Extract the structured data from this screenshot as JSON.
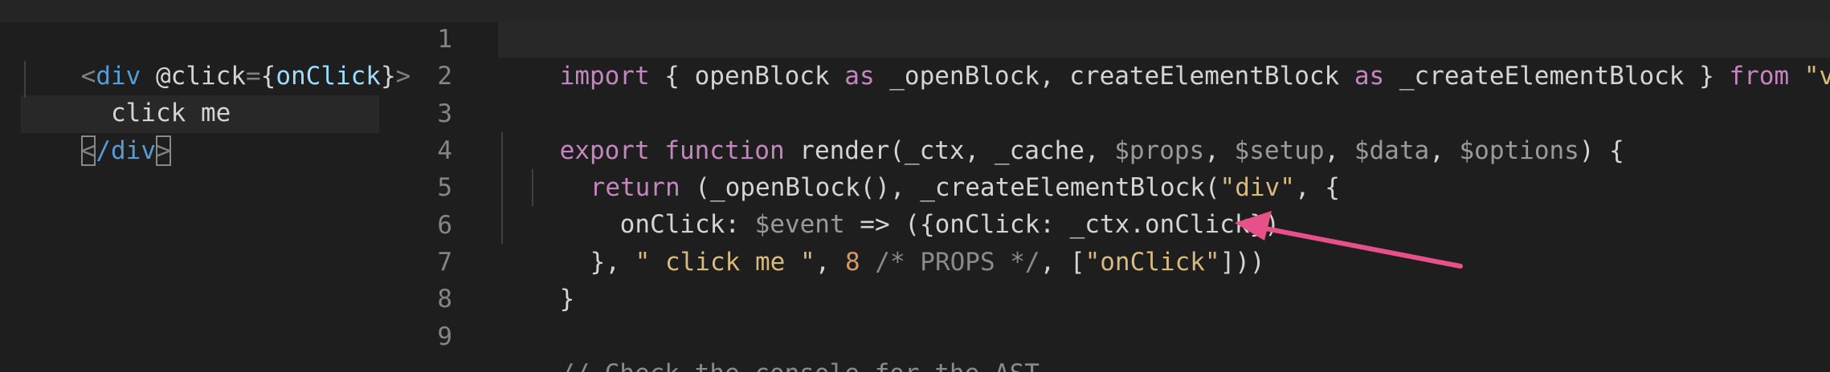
{
  "left_editor": {
    "lines": [
      {
        "open_angle": "<",
        "tag": "div",
        "space": " ",
        "event": "@click",
        "eq": "=",
        "brace_open": "{",
        "handler": "onClick",
        "brace_close": "}",
        "close_angle": ">"
      },
      {
        "text": "  click me"
      },
      {
        "open": "<",
        "slash": "/",
        "tag": "div",
        "close": ">"
      }
    ]
  },
  "right_editor": {
    "line_numbers": [
      "1",
      "2",
      "3",
      "4",
      "5",
      "6",
      "7",
      "8",
      "9"
    ],
    "code": {
      "l1": {
        "import": "import",
        "a": " { openBlock ",
        "as1": "as",
        "b": " _openBlock, createElementBlock ",
        "as2": "as",
        "c": " _createElementBlock } ",
        "from": "from",
        "d": " ",
        "module": "\"vue\""
      },
      "l3": {
        "export": "export",
        "function": " function ",
        "render": "render",
        "a": "(_ctx, _cache, ",
        "props": "$props",
        "c1": ", ",
        "setup": "$setup",
        "c2": ", ",
        "data": "$data",
        "c3": ", ",
        "options": "$options",
        "b": ") {"
      },
      "l4": {
        "ret": "return",
        "a": " (",
        "openBlock": "_openBlock",
        "b": "(), ",
        "createElementBlock": "_createElementBlock",
        "c": "(",
        "div": "\"div\"",
        "d": ", {"
      },
      "l5": {
        "onClick": "onClick",
        "a": ": ",
        "event": "$event",
        "b": " => ({onClick: _ctx.onClick})"
      },
      "l6": {
        "a": "}, ",
        "str": "\" click me \"",
        "b": ", ",
        "num": "8",
        "c": " ",
        "comment": "/* PROPS */",
        "d": ", [",
        "str2": "\"onClick\"",
        "e": "]))"
      },
      "l7": "}",
      "l9": "// Check the console for the AST"
    }
  },
  "colors": {
    "background": "#1e1e1e",
    "annotation_arrow": "#e8508a"
  }
}
